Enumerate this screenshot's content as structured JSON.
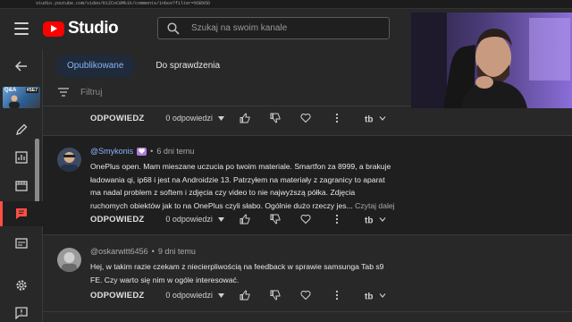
{
  "browser": {
    "url": "studio.youtube.com/video/KtZCoC8Mk1k/comments/inbox?filter=%5B%5D"
  },
  "header": {
    "logo_text": "Studio",
    "search_placeholder": "Szukaj na swoim kanale"
  },
  "sidebar": {
    "thumb_label_left": "Q&A",
    "thumb_label_right": "#SE7"
  },
  "tabs": [
    {
      "label": "Opublikowane",
      "active": true
    },
    {
      "label": "Do sprawdzenia",
      "active": false
    }
  ],
  "filter_label": "Filtruj",
  "comments": [
    {
      "reply_label": "ODPOWIEDZ",
      "replies_label": "0 odpowiedzi"
    },
    {
      "author": "@Smykonis",
      "time": "6 dni temu",
      "lines": [
        "OnePlus open. Mam mieszane uczucia po twoim materiale. Smartfon za 8999, a brakuje",
        "ładowania qi, ip68 i jest na Androidzie 13. Patrzyłem na materiały z zagranicy to aparat",
        "ma nadal problem z softem i zdjęcia czy video to nie najwyższą półka. Zdjęcia",
        "ruchomych obiektów jak to na OnePlus czyli słabo. Ogólnie dużo rzeczy jes..."
      ],
      "read_more": "Czytaj dalej",
      "reply_label": "ODPOWIEDZ",
      "replies_label": "0 odpowiedzi"
    },
    {
      "author": "@oskarwitt6456",
      "time": "9 dni temu",
      "lines": [
        "Hej, w takim razie czekam z niecierpliwością na feedback w sprawie samsunga Tab s9",
        "FE. Czy warto się nim w ogóle interesować."
      ],
      "reply_label": "ODPOWIEDZ",
      "replies_label": "0 odpowiedzi"
    }
  ],
  "colors": {
    "accent_blue": "#8ab4f8",
    "brand_red": "#ff0000",
    "active_indicator": "#ff4e45",
    "background": "#282828"
  }
}
